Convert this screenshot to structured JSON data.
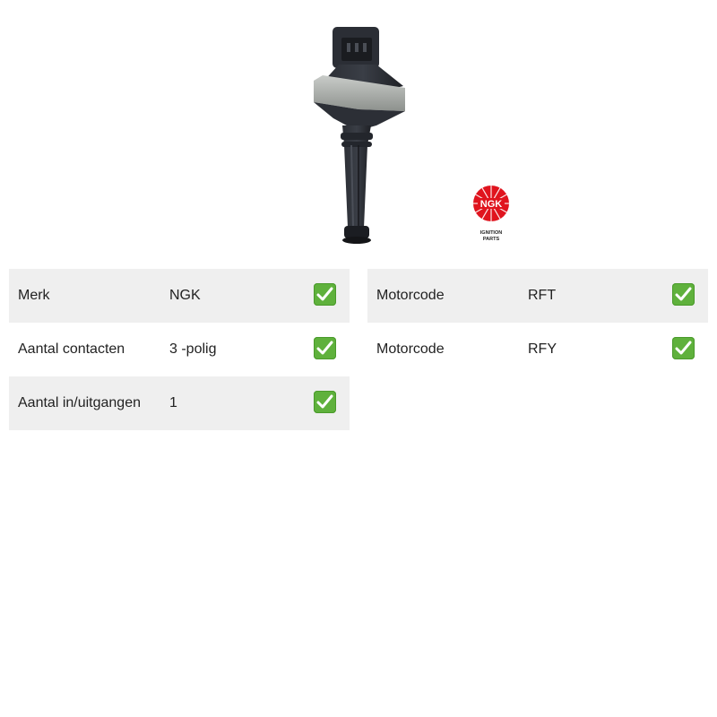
{
  "brand_logo": {
    "name": "NGK",
    "tagline_line1": "IGNITION",
    "tagline_line2": "PARTS",
    "color": "#e0141e"
  },
  "product_image": {
    "icon": "ignition-coil-image"
  },
  "specs_left": [
    {
      "label": "Merk",
      "value": "NGK",
      "check": true
    },
    {
      "label": "Aantal contacten",
      "value": "3 -polig",
      "check": true
    },
    {
      "label": "Aantal in/uitgangen",
      "value": "1",
      "check": true
    }
  ],
  "specs_right": [
    {
      "label": "Motorcode",
      "value": "RFT",
      "check": true
    },
    {
      "label": "Motorcode",
      "value": "RFY",
      "check": true
    }
  ],
  "colors": {
    "row_shade": "#efefef",
    "check_green": "#5fb13c",
    "text": "#222222"
  }
}
